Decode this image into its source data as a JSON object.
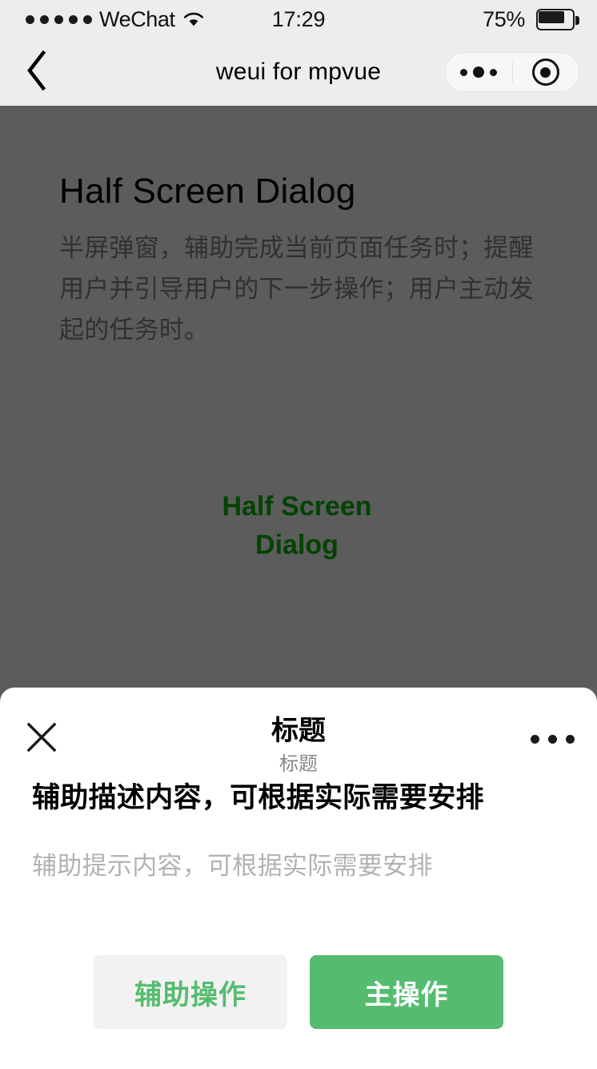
{
  "statusbar": {
    "carrier": "WeChat",
    "time": "17:29",
    "battery_percent": "75%",
    "signal_dots": 5,
    "wifi_icon": "wifi-icon",
    "battery_icon": "battery-icon",
    "battery_level": 75
  },
  "navbar": {
    "back_icon": "chevron-left-icon",
    "title": "weui for mpvue",
    "capsule": {
      "more_icon": "more-dots-icon",
      "target_icon": "target-circle-icon"
    }
  },
  "page": {
    "title": "Half Screen Dialog",
    "description": "半屏弹窗，辅助完成当前页面任务时；提醒用户并引导用户的下一步操作；用户主动发起的任务时。",
    "open_button_line1": "Half Screen",
    "open_button_line2": "Dialog"
  },
  "dialog": {
    "close_icon": "close-x-icon",
    "title": "标题",
    "subtitle": "标题",
    "more_icon": "more-dots-icon",
    "description": "辅助描述内容，可根据实际需要安排",
    "tips": "辅助提示内容，可根据实际需要安排",
    "secondary_button": "辅助操作",
    "primary_button": "主操作"
  },
  "colors": {
    "brand_green": "#55bc6f",
    "link_green": "#09bb07",
    "bar_background": "#ededed",
    "mask": "rgba(0,0,0,0.64)",
    "secondary_button_bg": "#f2f2f2",
    "muted_text": "#888888",
    "tips_text": "#b2b2b2"
  }
}
